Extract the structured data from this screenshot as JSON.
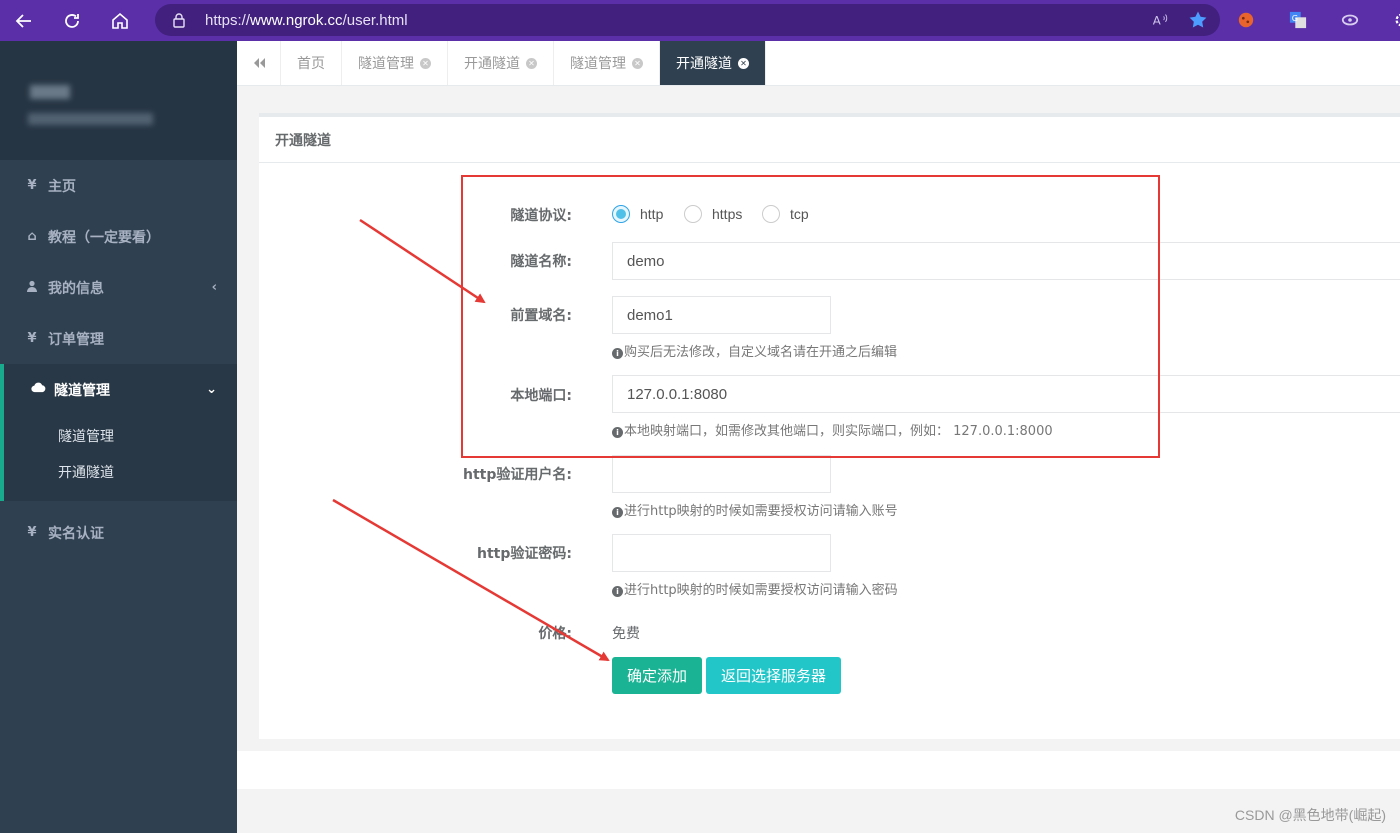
{
  "browser": {
    "url_prefix": "https://",
    "url_domain": "www.ngrok.cc",
    "url_path": "/user.html"
  },
  "sidebar": {
    "items": [
      {
        "label": "主页",
        "icon": "yen-icon"
      },
      {
        "label": "教程（一定要看）",
        "icon": "home-icon"
      },
      {
        "label": "我的信息",
        "icon": "user-icon"
      },
      {
        "label": "订单管理",
        "icon": "yen-icon"
      },
      {
        "label": "隧道管理",
        "icon": "cloud-icon"
      },
      {
        "label": "实名认证",
        "icon": "yen-icon"
      }
    ],
    "submenu": [
      "隧道管理",
      "开通隧道"
    ]
  },
  "tabs": [
    "首页",
    "隧道管理",
    "开通隧道",
    "隧道管理",
    "开通隧道"
  ],
  "panel": {
    "title": "开通隧道"
  },
  "form": {
    "protocol_label": "隧道协议:",
    "protocol_options": [
      "http",
      "https",
      "tcp"
    ],
    "protocol_selected": "http",
    "name_label": "隧道名称:",
    "name_value": "demo",
    "subdomain_label": "前置域名:",
    "subdomain_value": "demo1",
    "subdomain_help": "购买后无法修改，自定义域名请在开通之后编辑",
    "port_label": "本地端口:",
    "port_value": "127.0.0.1:8080",
    "port_help": "本地映射端口，如需修改其他端口，则实际端口，例如：  127.0.0.1:8000",
    "http_user_label": "http验证用户名:",
    "http_user_help": "进行http映射的时候如需要授权访问请输入账号",
    "http_pass_label": "http验证密码:",
    "http_pass_help": "进行http映射的时候如需要授权访问请输入密码",
    "price_label": "价格:",
    "price_value": "免费",
    "submit_label": "确定添加",
    "back_label": "返回选择服务器"
  },
  "watermark": "CSDN @黑色地带(崛起)",
  "colors": {
    "browser_bar": "#5b2fa8",
    "sidebar": "#2f4050",
    "primary": "#1ab394",
    "info": "#23c6c8",
    "annotation": "#e53935"
  }
}
